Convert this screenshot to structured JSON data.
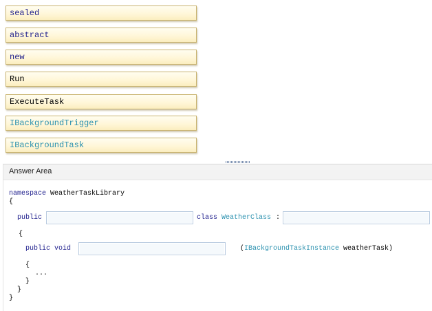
{
  "choices": [
    {
      "label": "sealed",
      "kind": "keyword"
    },
    {
      "label": "abstract",
      "kind": "keyword"
    },
    {
      "label": "new",
      "kind": "keyword"
    },
    {
      "label": "Run",
      "kind": "plain"
    },
    {
      "label": "ExecuteTask",
      "kind": "plain"
    },
    {
      "label": "IBackgroundTrigger",
      "kind": "type"
    },
    {
      "label": "IBackgroundTask",
      "kind": "type"
    }
  ],
  "answer_area": {
    "title": "Answer Area"
  },
  "code": {
    "namespace_keyword": "namespace",
    "namespace_name": "WeatherTaskLibrary",
    "open_brace_ns": "{",
    "class_public": "public",
    "class_keyword": "class",
    "class_name": "WeatherClass",
    "colon": ":",
    "open_brace_class": "{",
    "method_public_void": "public void",
    "param_open": "(",
    "param_type": "IBackgroundTaskInstance",
    "param_name": " weatherTask)",
    "open_brace_method": "{",
    "ellipsis": "...",
    "close_brace_method": "}",
    "close_brace_class": "}",
    "close_brace_ns": "}"
  },
  "colors": {
    "keyword": "#1e1e8c",
    "type": "#2b91af",
    "tile_border": "#c9b36e",
    "tile_background": "#fff6d6",
    "drop_border": "#b9cbe0"
  }
}
